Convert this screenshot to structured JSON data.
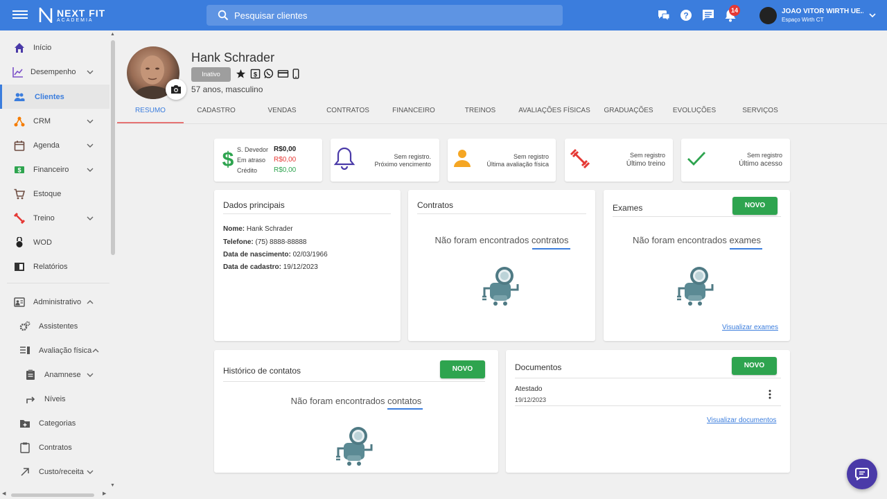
{
  "topbar": {
    "logo_line1": "NEXT FIT",
    "logo_line2": "ACADEMIA",
    "search_placeholder": "Pesquisar clientes",
    "notifications_count": "14",
    "user_name": "JOAO VITOR WIRTH UE...",
    "user_subtitle": "Espaço Wirth CT",
    "icons": [
      "menu-icon",
      "whatsapp-chat-icon",
      "help-icon",
      "message-icon",
      "bell-icon",
      "chevron-down-icon"
    ]
  },
  "sidebar": {
    "items": [
      {
        "label": "Início",
        "icon": "home-icon"
      },
      {
        "label": "Desempenho",
        "icon": "chart-line-icon"
      },
      {
        "label": "Clientes",
        "icon": "people-icon"
      },
      {
        "label": "CRM",
        "icon": "crm-icon"
      },
      {
        "label": "Agenda",
        "icon": "calendar-icon"
      },
      {
        "label": "Financeiro",
        "icon": "money-icon"
      },
      {
        "label": "Estoque",
        "icon": "cart-icon"
      },
      {
        "label": "Treino",
        "icon": "dumbbell-icon"
      },
      {
        "label": "WOD",
        "icon": "kettlebell-icon"
      },
      {
        "label": "Relatórios",
        "icon": "report-icon"
      },
      {
        "label": "Administrativo",
        "icon": "id-card-icon"
      },
      {
        "label": "Assistentes",
        "icon": "gears-icon"
      },
      {
        "label": "Avaliação física",
        "icon": "list-icon"
      },
      {
        "label": "Anamnese",
        "icon": "clipboard-icon"
      },
      {
        "label": "Níveis",
        "icon": "level-icon"
      },
      {
        "label": "Categorias",
        "icon": "folder-plus-icon"
      },
      {
        "label": "Contratos",
        "icon": "clipboard-icon"
      },
      {
        "label": "Custo/receita",
        "icon": "arrow-diagonal-icon"
      }
    ]
  },
  "client": {
    "name": "Hank Schrader",
    "status": "Inativo",
    "subtitle": "57 anos, masculino"
  },
  "tabs": [
    "RESUMO",
    "CADASTRO",
    "VENDAS",
    "CONTRATOS",
    "FINANCEIRO",
    "TREINOS",
    "AVALIAÇÕES FÍSICAS",
    "GRADUAÇÕES",
    "EVOLUÇÕES",
    "SERVIÇOS"
  ],
  "summary": {
    "balance": {
      "rows": [
        {
          "label": "S. Devedor",
          "value": "R$0,00",
          "color": "#222222"
        },
        {
          "label": "Em atraso",
          "value": "R$0,00",
          "color": "#e53935"
        },
        {
          "label": "Crédito",
          "value": "R$0,00",
          "color": "#2ea44f"
        }
      ]
    },
    "next_due": {
      "line1": "Sem registro.",
      "line2": "Próximo vencimento"
    },
    "last_assessment": {
      "line1": "Sem registro",
      "line2": "Última avaliação física"
    },
    "last_workout": {
      "line1": "Sem registro",
      "line2": "Último treino"
    },
    "last_access": {
      "line1": "Sem registro",
      "line2": "Último acesso"
    }
  },
  "dados_principais": {
    "title": "Dados principais",
    "rows": [
      {
        "label": "Nome:",
        "value": "Hank Schrader"
      },
      {
        "label": "Telefone:",
        "value": "(75) 8888-88888"
      },
      {
        "label": "Data de nascimento:",
        "value": "02/03/1966"
      },
      {
        "label": "Data de cadastro:",
        "value": "19/12/2023"
      }
    ]
  },
  "contratos": {
    "title": "Contratos",
    "empty_prefix": "Não foram encontrados",
    "empty_word": "contratos"
  },
  "exames": {
    "title": "Exames",
    "button": "NOVO",
    "empty_prefix": "Não foram encontrados",
    "empty_word": "exames",
    "link": "Visualizar exames"
  },
  "historico": {
    "title": "Histórico de contatos",
    "button": "NOVO",
    "empty_prefix": "Não foram encontrados",
    "empty_word": "contatos"
  },
  "documentos": {
    "title": "Documentos",
    "button": "NOVO",
    "items": [
      {
        "name": "Atestado",
        "date": "19/12/2023"
      }
    ],
    "link": "Visualizar documentos"
  },
  "colors": {
    "primary": "#3b7ddd",
    "success": "#2ea44f",
    "danger": "#e53935",
    "chat": "#4a3aa8"
  }
}
